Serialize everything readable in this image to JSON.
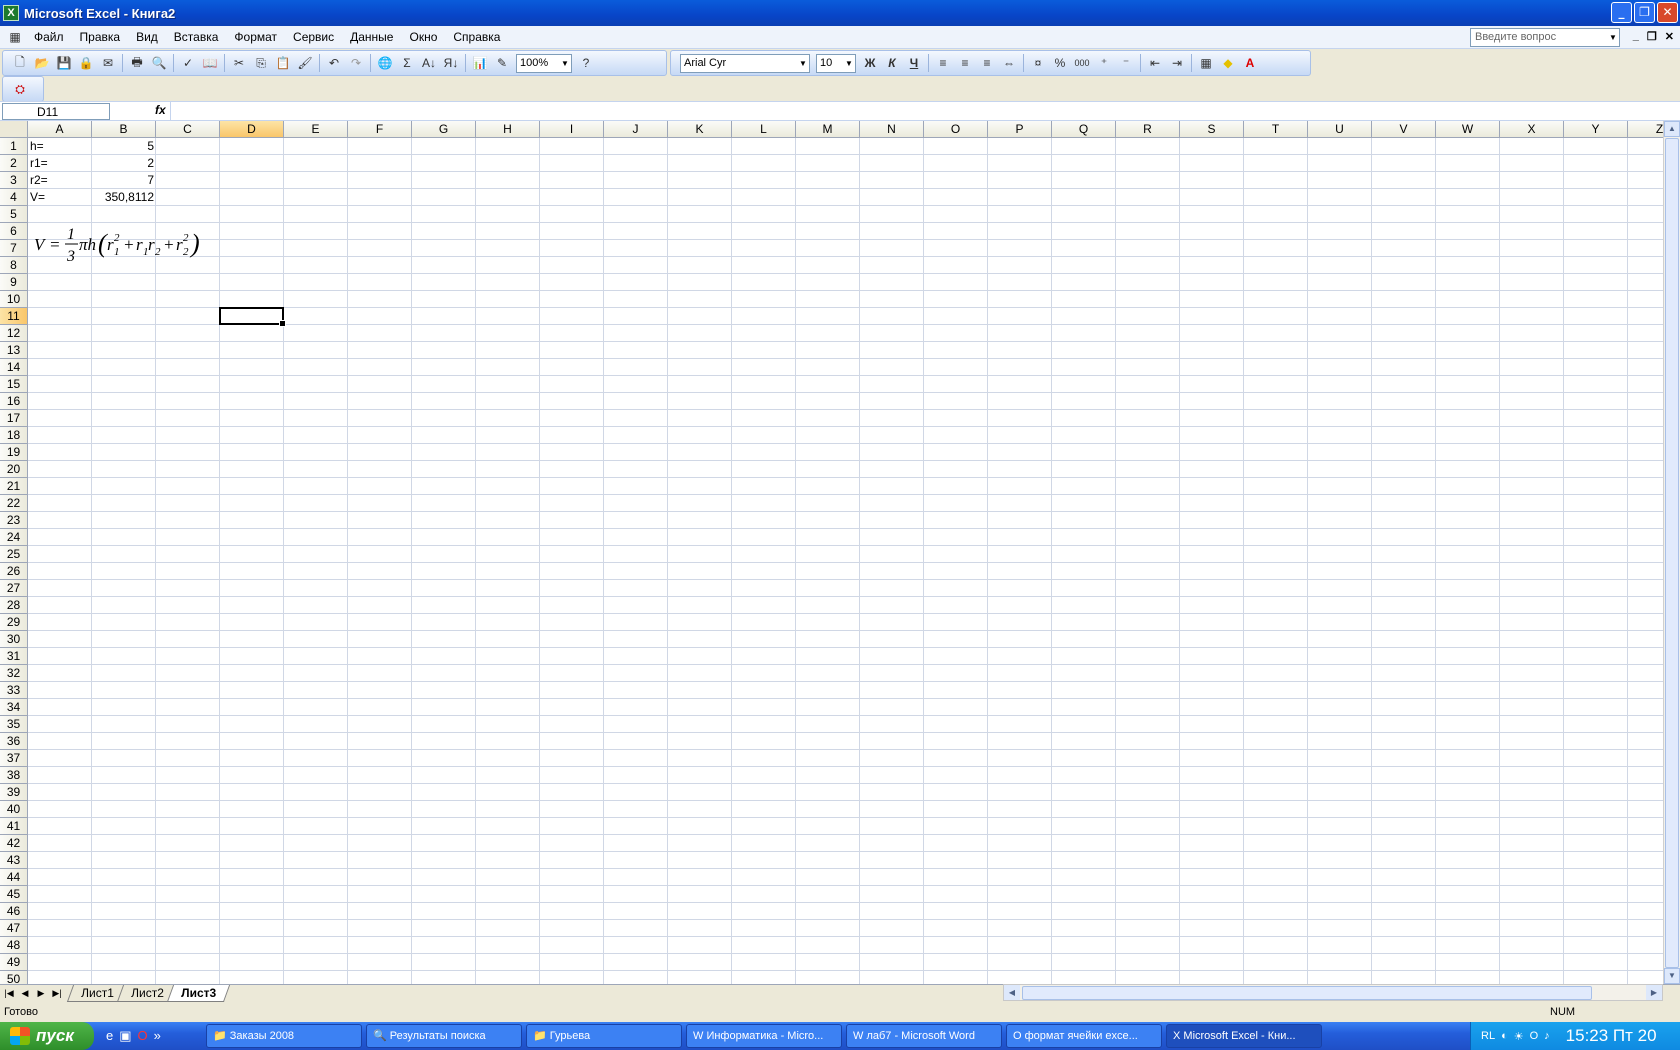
{
  "window": {
    "title": "Microsoft Excel - Книга2",
    "app_icon": "excel-icon"
  },
  "menu": [
    "Файл",
    "Правка",
    "Вид",
    "Вставка",
    "Формат",
    "Сервис",
    "Данные",
    "Окно",
    "Справка"
  ],
  "help_box": {
    "placeholder": "Введите вопрос"
  },
  "toolbar": {
    "zoom": "100%",
    "font": "Arial Cyr",
    "font_size": "10",
    "bold": "Ж",
    "italic": "К",
    "underline": "Ч",
    "percent": "%",
    "thousands": "000",
    "sum": "Σ"
  },
  "formula_bar": {
    "name_box": "D11",
    "fx": "fx",
    "content": ""
  },
  "columns": [
    "A",
    "B",
    "C",
    "D",
    "E",
    "F",
    "G",
    "H",
    "I",
    "J",
    "K",
    "L",
    "M",
    "N",
    "O",
    "P",
    "Q",
    "R",
    "S",
    "T",
    "U",
    "V",
    "W",
    "X",
    "Y",
    "Z"
  ],
  "selected_column": "D",
  "selected_row": 11,
  "rows_count": 50,
  "cells": {
    "A1": "h=",
    "B1": "5",
    "A2": "r1=",
    "B2": "2",
    "A3": "r2=",
    "B3": "7",
    "A4": "V=",
    "B4": "350,8112"
  },
  "formula_object": {
    "V": "V",
    "eq": "=",
    "num": "1",
    "den": "3",
    "pi_h": "πh",
    "r1": "r",
    "sub1": "1",
    "sup2": "2",
    "plus": "+",
    "r1r2": "r",
    "sub2": "2"
  },
  "sheets": [
    "Лист1",
    "Лист2",
    "Лист3"
  ],
  "active_sheet": "Лист3",
  "status": {
    "text": "Готово",
    "num": "NUM"
  },
  "taskbar": {
    "start": "пуск",
    "tasks": [
      "Заказы 2008",
      "Результаты поиска",
      "Гурьева",
      "Информатика - Micro...",
      "лаб7 - Microsoft Word",
      "формат ячейки exce...",
      "Microsoft Excel - Кни..."
    ],
    "lang": "RL",
    "clock": "15:23 Пт 20"
  }
}
